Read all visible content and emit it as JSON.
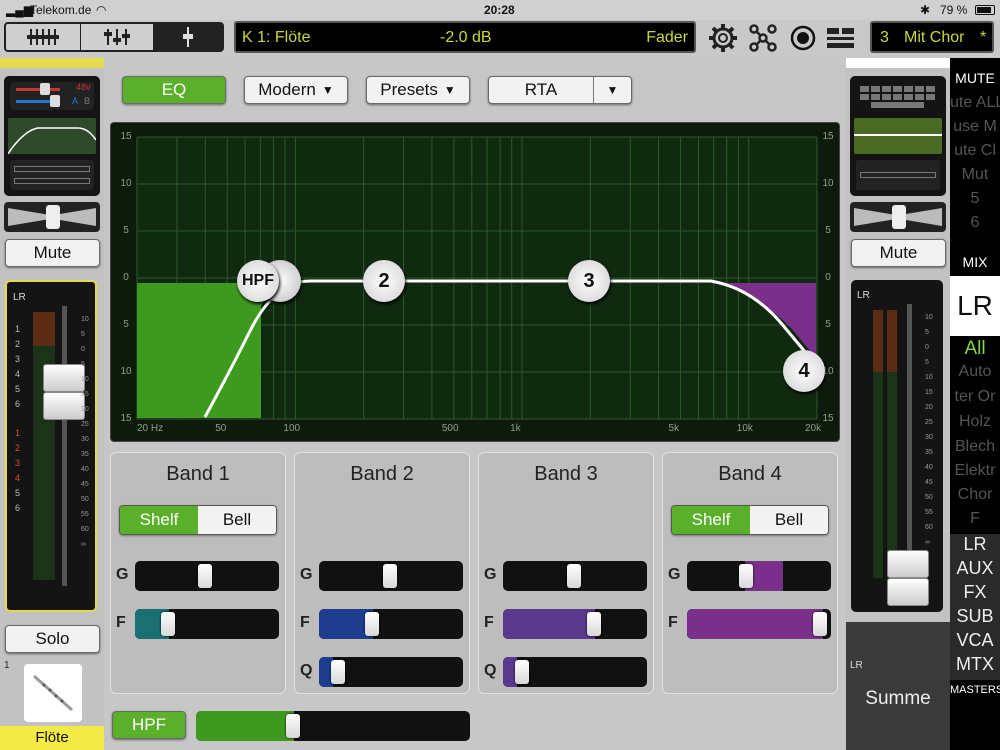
{
  "status": {
    "carrier": "Telekom.de",
    "time": "20:28",
    "battery": "79 %"
  },
  "toolbar": {
    "channel_name": "K 1: Flöte",
    "value": "-2.0 dB",
    "mode": "Fader",
    "snapshot_number": "3",
    "snapshot_name": "Mit Chor",
    "snapshot_modified": "*"
  },
  "eq_bar": {
    "eq_label": "EQ",
    "curve_mode": "Modern",
    "presets_label": "Presets",
    "rta_label": "RTA"
  },
  "graph": {
    "y_ticks": [
      "15",
      "10",
      "5",
      "0",
      "5",
      "10",
      "15"
    ],
    "x_ticks": [
      "20 Hz",
      "50",
      "100",
      "500",
      "1k",
      "5k",
      "10k",
      "20k"
    ],
    "nodes": [
      "HPF",
      "2",
      "3",
      "4"
    ]
  },
  "bands": [
    {
      "title": "Band 1",
      "shelf": "Shelf",
      "bell": "Bell",
      "g": "G",
      "f": "F"
    },
    {
      "title": "Band 2",
      "g": "G",
      "f": "F",
      "q": "Q"
    },
    {
      "title": "Band 3",
      "g": "G",
      "f": "F",
      "q": "Q"
    },
    {
      "title": "Band 4",
      "shelf": "Shelf",
      "bell": "Bell",
      "g": "G",
      "f": "F"
    }
  ],
  "hpf_label": "HPF",
  "left_strip": {
    "phantom": "48v",
    "a_label": "A",
    "b_label": "B",
    "mute_label": "Mute",
    "lr_label": "LR",
    "meter_scale": [
      "1",
      "2",
      "3",
      "4",
      "5",
      "6",
      "1",
      "2",
      "3",
      "4",
      "5",
      "6"
    ],
    "solo_label": "Solo",
    "channel_number": "1",
    "channel_name": "Flöte"
  },
  "right_strip": {
    "mute_label": "Mute",
    "lr_label": "LR",
    "bus_label": "LR",
    "bus_name": "Summe"
  },
  "masters": {
    "mute_header": "MUTE",
    "mute_groups": [
      "ute ALL",
      "use M",
      "ute Cl",
      "Mut",
      "5",
      "6"
    ],
    "mix_header": "MIX",
    "mix_selected": "LR",
    "filter_items": [
      "All",
      "Auto",
      "ter Or",
      "Holz",
      "Blech",
      "Elektr",
      "Chor",
      "F"
    ],
    "bus_types": [
      "LR",
      "AUX",
      "FX",
      "SUB",
      "VCA",
      "MTX"
    ],
    "masters_label": "MASTERS"
  },
  "colors": {
    "accent_green": "#5ab02a",
    "lcd_text": "#ccd63a",
    "band2": "#1e3d8f",
    "band3": "#5a3a8c",
    "band4": "#7a2f8a",
    "band1": "#1a6f73"
  }
}
